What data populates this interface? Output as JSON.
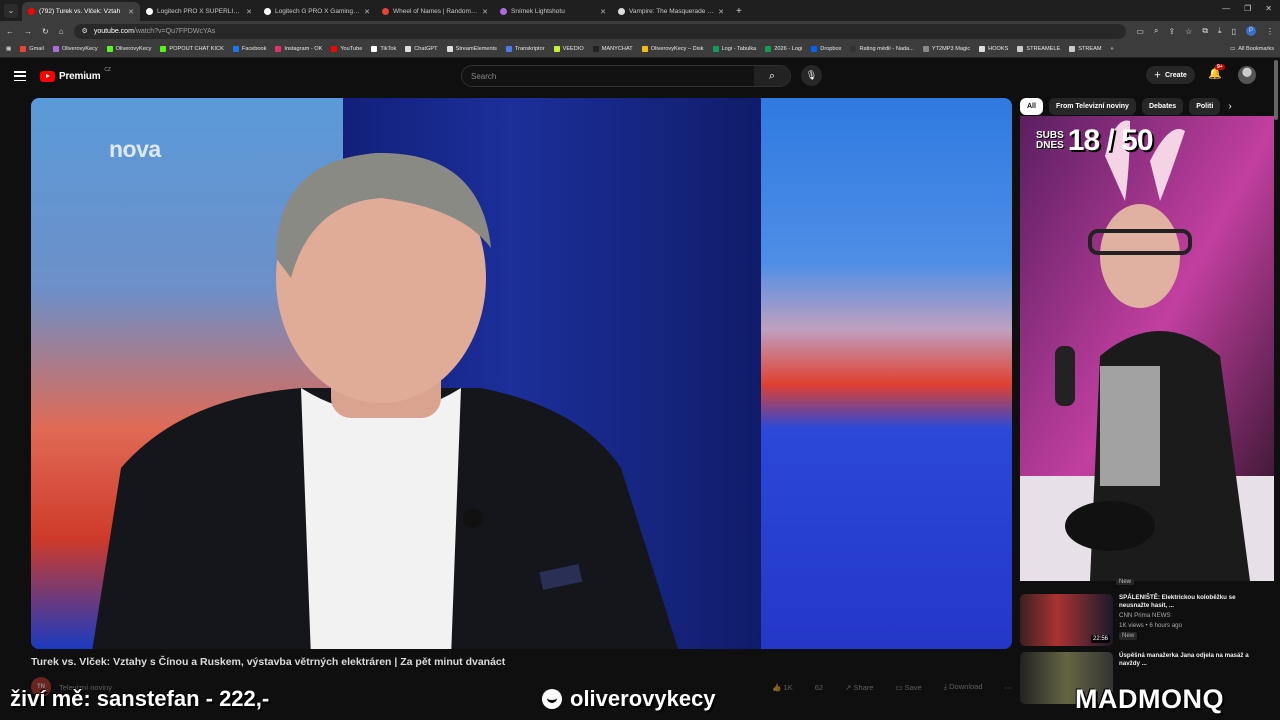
{
  "browser": {
    "tabs": [
      {
        "label": "(792) Turek vs. Vlček: Vztah",
        "color": "#ff0000",
        "active": true
      },
      {
        "label": "Logitech PRO X SUPERLIGHT 2",
        "color": "#ffffff",
        "active": false
      },
      {
        "label": "Logitech G PRO X Gaming Hea",
        "color": "#ffffff",
        "active": false
      },
      {
        "label": "Wheel of Names | Random nam",
        "color": "#ea4335",
        "active": false
      },
      {
        "label": "Snímek Lightshotu",
        "color": "#b06ae0",
        "active": false
      },
      {
        "label": "Vampire: The Masquerade - Bl",
        "color": "#dddddd",
        "active": false
      }
    ],
    "new_tab": "+",
    "url_host": "youtube.com",
    "url_path": "/watch?v=Qu7FPDWcYAs",
    "bookmarks": [
      {
        "label": "Gmail",
        "color": "#ea4335"
      },
      {
        "label": "OliverovyKecy",
        "color": "#b06ae0"
      },
      {
        "label": "OliverovyKecy",
        "color": "#53fc18"
      },
      {
        "label": "POPOUT CHAT KICK",
        "color": "#53fc18"
      },
      {
        "label": "Facebook",
        "color": "#1877f2"
      },
      {
        "label": "Instagram - OK",
        "color": "#e1306c"
      },
      {
        "label": "YouTube",
        "color": "#ff0000"
      },
      {
        "label": "TikTok",
        "color": "#ffffff"
      },
      {
        "label": "ChatGPT",
        "color": "#dddddd"
      },
      {
        "label": "StreamElements",
        "color": "#dddddd"
      },
      {
        "label": "Transkriptor",
        "color": "#4a7cf0"
      },
      {
        "label": "VEEDIO",
        "color": "#c6f432"
      },
      {
        "label": "MANYCHAT",
        "color": "#222222"
      },
      {
        "label": "OliverovyKecy – Disk",
        "color": "#fbbc05"
      },
      {
        "label": "Logi - Tabulka",
        "color": "#0f9d58"
      },
      {
        "label": "2026 - Logi",
        "color": "#0f9d58"
      },
      {
        "label": "Dropbox",
        "color": "#0061ff"
      },
      {
        "label": "Rating médií - Nada...",
        "color": "#333333"
      },
      {
        "label": "YT2MP3 Magic",
        "color": "#888888"
      },
      {
        "label": "HOOKS",
        "color": "#dddddd"
      },
      {
        "label": "STREAMELE",
        "color": "#cccccc"
      },
      {
        "label": "STREAM",
        "color": "#cccccc"
      }
    ],
    "all_bookmarks": "All Bookmarks"
  },
  "youtube": {
    "logo_text": "Premium",
    "logo_country": "CZ",
    "search_placeholder": "Search",
    "create_label": "Create",
    "notif_count": "9+",
    "chips": [
      "All",
      "From Televizní noviny",
      "Debates",
      "Politi"
    ],
    "video": {
      "channel_logo": "nova",
      "title": "Turek vs. Vlček: Vztahy s Čínou a Ruskem, výstavba větrných elektráren | Za pět minut dvanáct",
      "channel": "Televizní noviny",
      "channel_avatar": "TN",
      "likes": "1K",
      "comments": "62",
      "share": "Share",
      "save": "Save",
      "download": "Download"
    },
    "recommendations": [
      {
        "title": "SPÁLENIŠTĚ: Elektrickou koloběžku se neusnažte hasit, ...",
        "channel": "CNN Prima NEWS",
        "stats": "1K views • 6 hours ago",
        "badge": "New",
        "duration": "22:56"
      },
      {
        "title": "Úspěšná manažerka Jana odjela na masáž a navždy ...",
        "channel": "",
        "stats": "",
        "badge": "",
        "duration": ""
      }
    ],
    "rec_new_above": "New"
  },
  "stream_overlay": {
    "subs_label_1": "SUBS",
    "subs_label_2": "DNES",
    "subs_count": "18 / 50",
    "donation": "živí mě: sanstefan - 222,-",
    "handle": "oliverovykecy",
    "brand": "MADMONQ"
  },
  "colors": {
    "yt_red": "#ff0000",
    "bg": "#0f0f0f"
  }
}
